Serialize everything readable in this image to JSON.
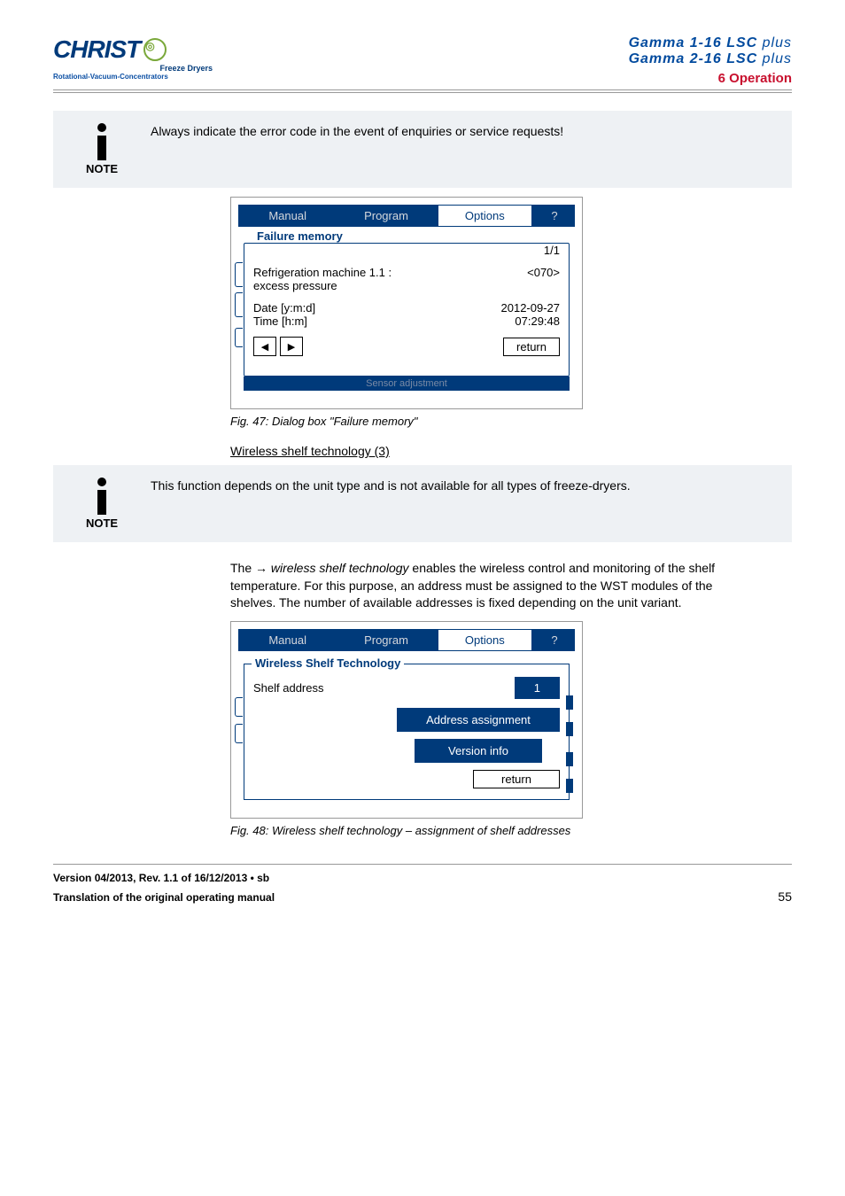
{
  "header": {
    "prod1": "Gamma 1-16 LSC",
    "prod2": "Gamma 2-16 LSC",
    "plus": "plus",
    "section": "6 Operation",
    "sub1": "Freeze Dryers",
    "sub2": "Rotational-Vacuum-Concentrators"
  },
  "note1": {
    "label": "NOTE",
    "text": "Always indicate the error code in the event of enquiries or service requests!"
  },
  "dlg1": {
    "tabs": {
      "manual": "Manual",
      "program": "Program",
      "options": "Options",
      "q": "?"
    },
    "title": "Failure memory",
    "count": "1/1",
    "r1a": "Refrigeration machine 1.1 :",
    "r1b": "excess pressure",
    "r1v": "<070>",
    "r2a": "Date [y:m:d]",
    "r2b": "Time [h:m]",
    "r2v1": "2012-09-27",
    "r2v2": "07:29:48",
    "return": "return",
    "ghost": "Sensor adjustment"
  },
  "cap1": "Fig. 47: Dialog box \"Failure memory\"",
  "subhead": "Wireless shelf technology (3)",
  "note2": {
    "label": "NOTE",
    "text": "This function depends on the unit type and is not available for all types of freeze-dryers."
  },
  "para": "The → wireless shelf technology enables the wireless control and monitoring of the shelf temperature. For this purpose, an address must be assigned to the WST modules of the shelves. The number of available addresses is fixed depending on the unit variant.",
  "paraPrefix": "The → ",
  "paraItalic": "wireless shelf technology",
  "paraRest": " enables the wireless control and monitoring of the shelf temperature. For this purpose, an address must be assigned to the WST modules of the shelves. The number of available addresses is fixed depending on the unit variant.",
  "dlg2": {
    "tabs": {
      "manual": "Manual",
      "program": "Program",
      "options": "Options",
      "q": "?"
    },
    "title": "Wireless Shelf Technology",
    "shelf": "Shelf address",
    "val": "1",
    "btn1": "Address assignment",
    "btn2": "Version info",
    "return": "return"
  },
  "cap2": "Fig. 48: Wireless shelf technology – assignment of shelf addresses",
  "footer": {
    "l1": "Version 04/2013, Rev. 1.1 of 16/12/2013 • sb",
    "l2": "Translation of the original operating manual",
    "pg": "55"
  }
}
